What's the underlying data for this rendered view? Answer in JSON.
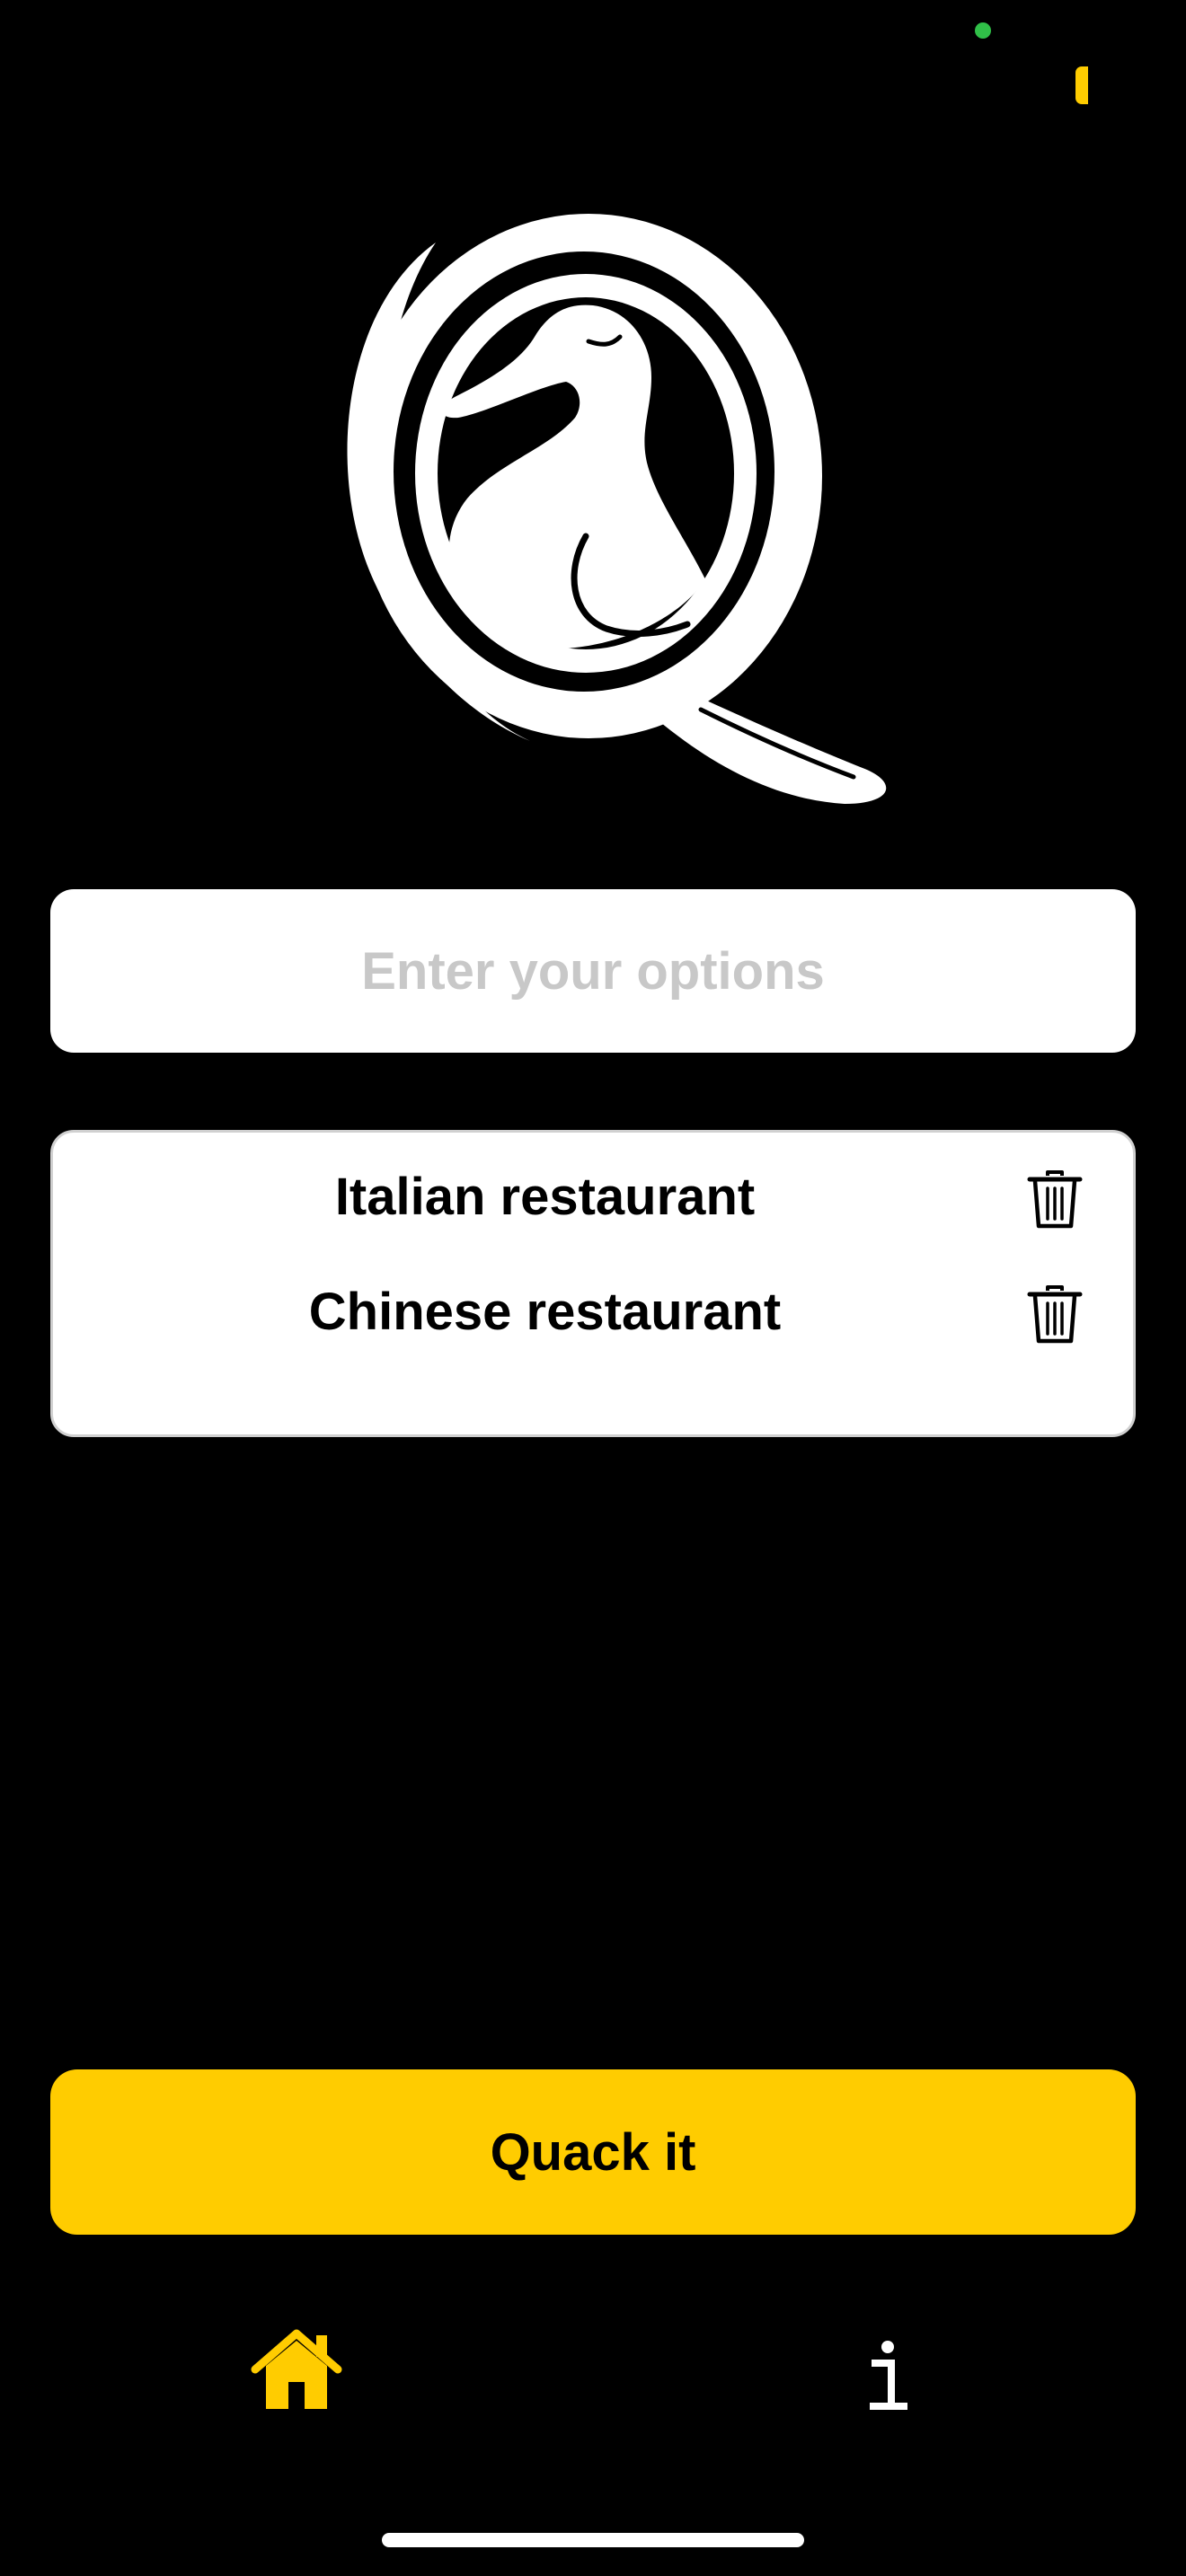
{
  "input": {
    "placeholder": "Enter your options",
    "value": ""
  },
  "options": [
    {
      "label": "Italian restaurant",
      "delete_icon": "trash-icon"
    },
    {
      "label": "Chinese restaurant",
      "delete_icon": "trash-icon"
    }
  ],
  "primary_action": {
    "label": "Quack it"
  },
  "tab_bar": {
    "tabs": [
      {
        "name": "home",
        "icon": "house-icon",
        "active": true
      },
      {
        "name": "info",
        "icon": "info-icon",
        "active": false
      }
    ]
  },
  "colors": {
    "background": "#000000",
    "accent": "#ffcc00",
    "card": "#ffffff",
    "placeholder": "#c8c8c8",
    "camera_indicator": "#30c048"
  }
}
